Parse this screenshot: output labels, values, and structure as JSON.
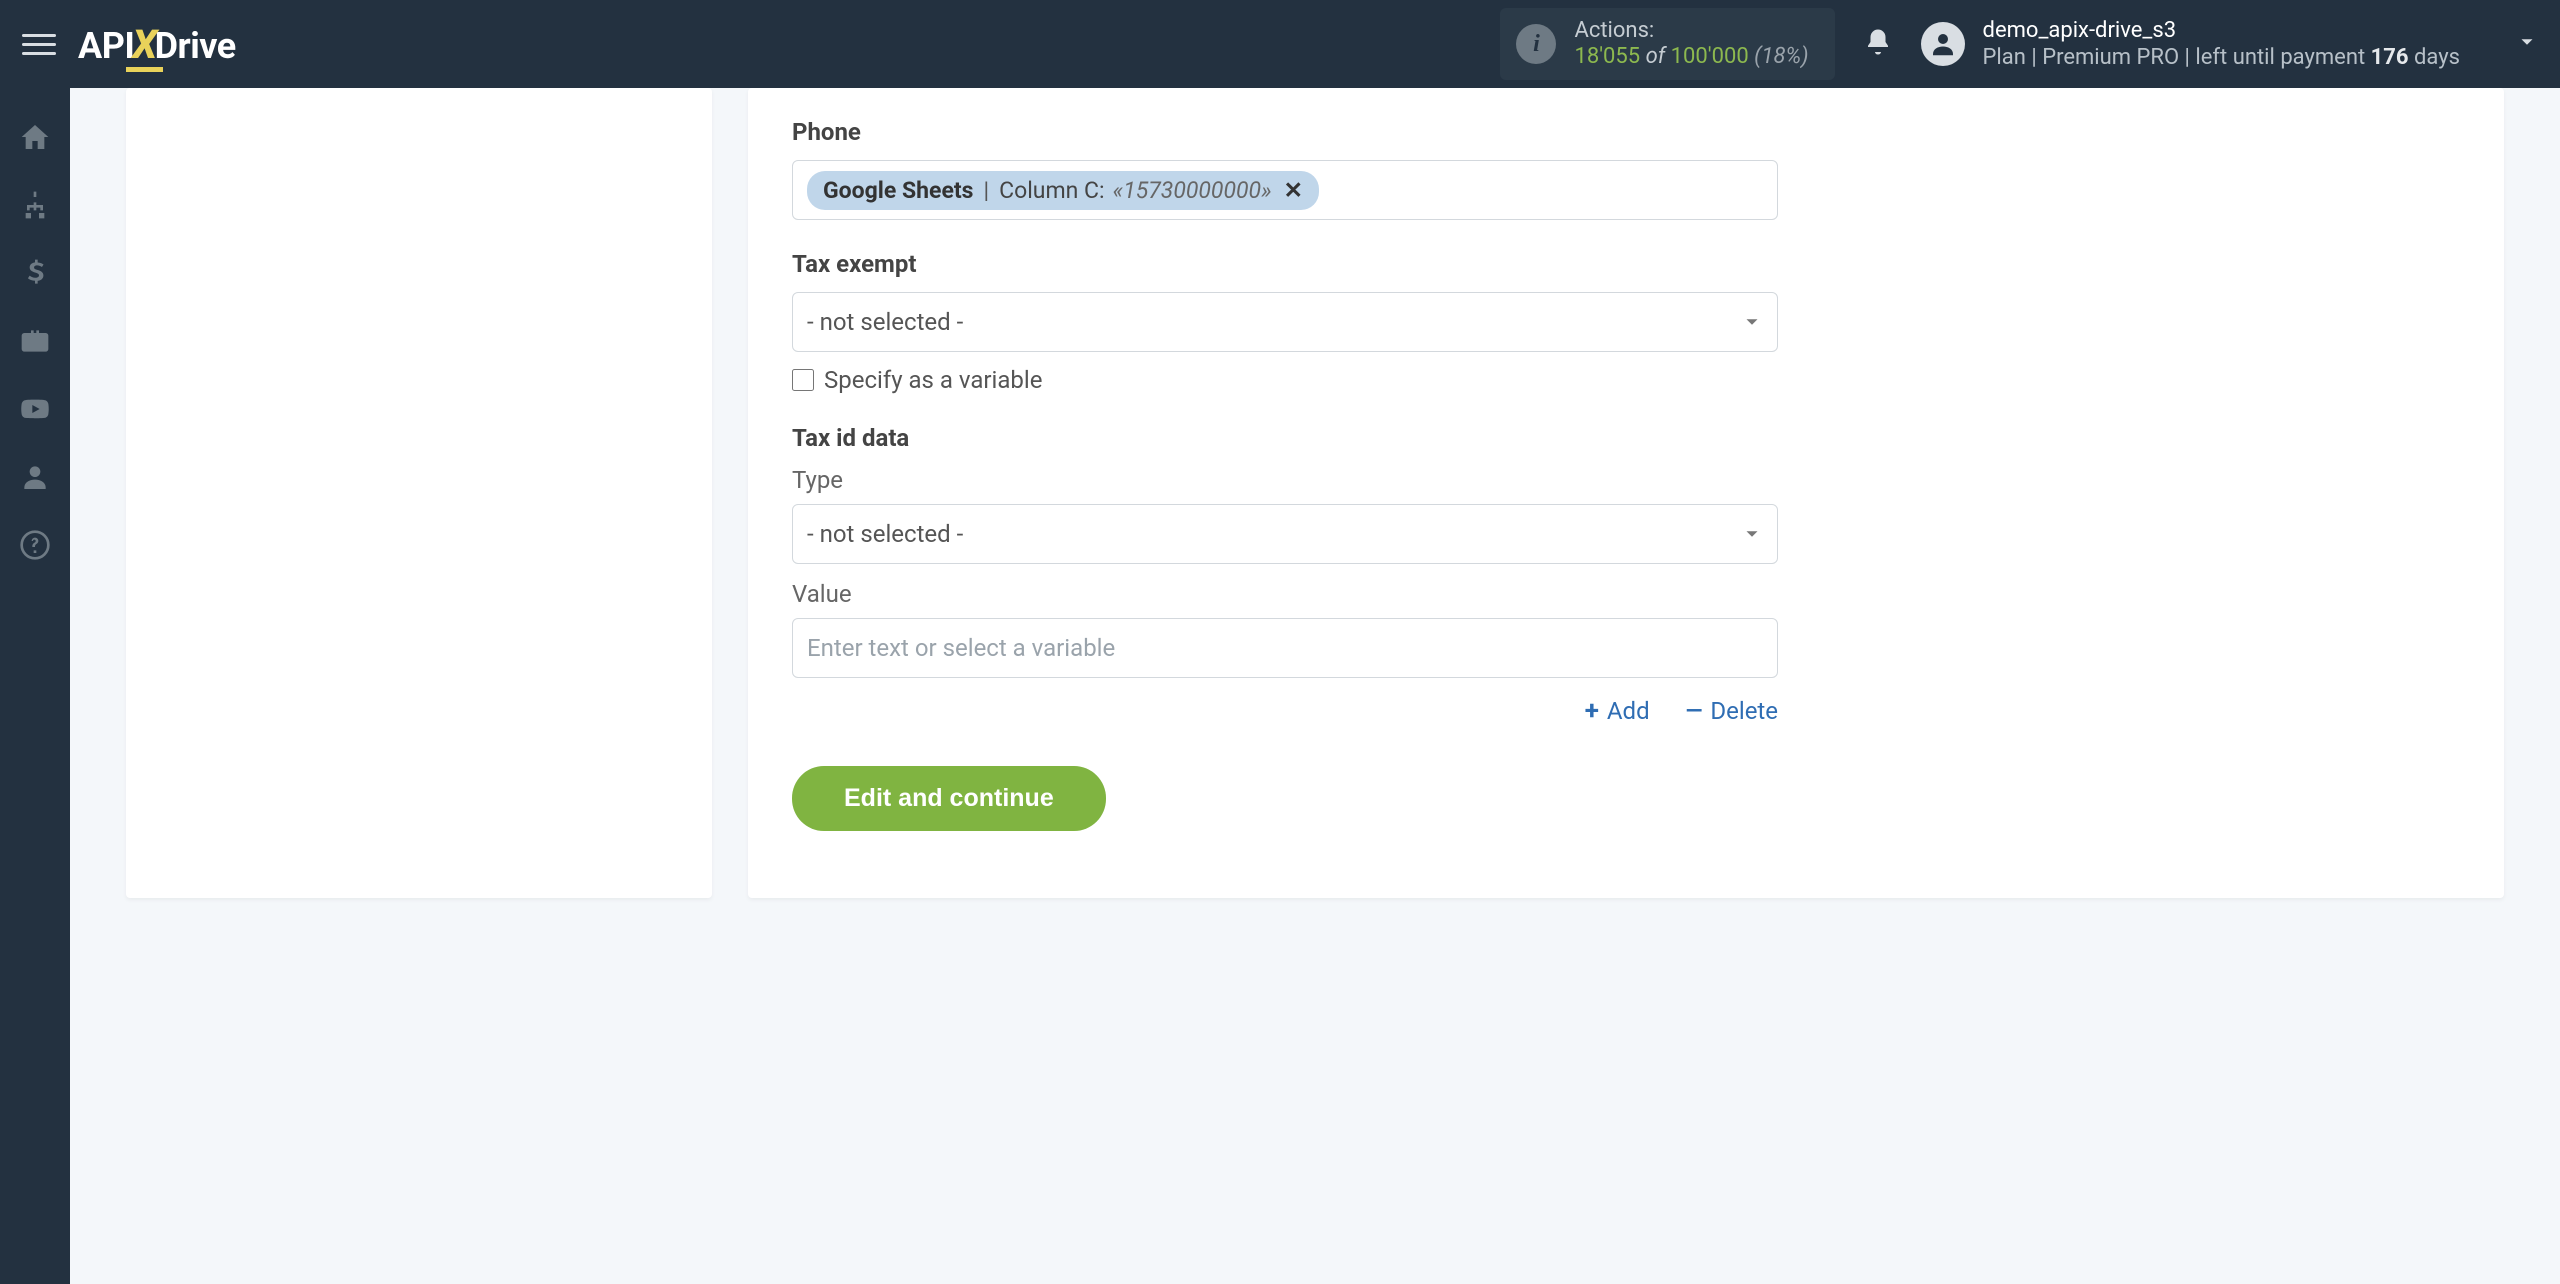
{
  "header": {
    "logo": {
      "part1": "API",
      "part2": "X",
      "part3": "Drive"
    },
    "actions": {
      "label": "Actions:",
      "used": "18'055",
      "of": "of",
      "total": "100'000",
      "pct": "(18%)"
    },
    "user": {
      "name": "demo_apix-drive_s3",
      "plan_prefix": "Plan |",
      "plan_name": "Premium PRO",
      "plan_suffix": "| left until payment",
      "days_num": "176",
      "days_word": "days"
    }
  },
  "sidebar": {
    "items": [
      "home",
      "sitemap",
      "dollar",
      "briefcase",
      "youtube",
      "user",
      "help"
    ]
  },
  "form": {
    "phone": {
      "label": "Phone",
      "token_source": "Google Sheets",
      "token_sep": "|",
      "token_col": "Column C:",
      "token_val": "«15730000000»"
    },
    "tax_exempt": {
      "label": "Tax exempt",
      "placeholder": "- not selected -",
      "checkbox_label": "Specify as a variable"
    },
    "tax_id": {
      "section_label": "Tax id data",
      "type_label": "Type",
      "type_placeholder": "- not selected -",
      "value_label": "Value",
      "value_placeholder": "Enter text or select a variable"
    },
    "actions": {
      "add": "Add",
      "delete": "Delete"
    },
    "submit": "Edit and continue"
  }
}
